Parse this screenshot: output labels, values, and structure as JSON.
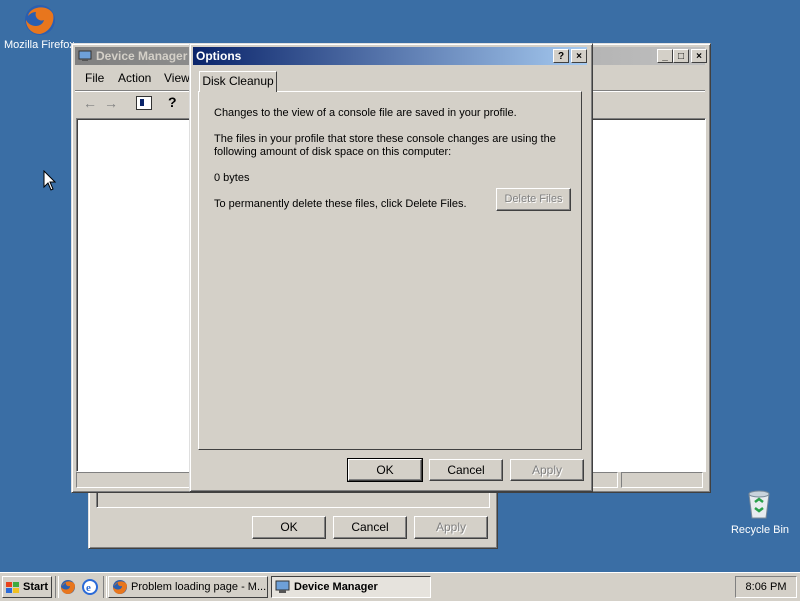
{
  "desktop": {
    "firefox_label": "Mozilla Firefox",
    "recycle_label": "Recycle Bin"
  },
  "device_manager": {
    "title": "Device Manager",
    "menu": [
      "File",
      "Action",
      "View"
    ]
  },
  "back_dialog": {
    "ok": "OK",
    "cancel": "Cancel",
    "apply": "Apply"
  },
  "options": {
    "title": "Options",
    "help_btn": "?",
    "close_btn": "×",
    "tab": "Disk Cleanup",
    "line1": "Changes to the view of a console file are saved in your profile.",
    "line2a": "The files in your profile that store these console changes are using the",
    "line2b": "following amount of disk space on this computer:",
    "size": "0 bytes",
    "delete_prompt": "To permanently delete these files, click Delete Files.",
    "delete_button": "Delete Files",
    "ok": "OK",
    "cancel": "Cancel",
    "apply": "Apply"
  },
  "taskbar": {
    "start": "Start",
    "task1": "Problem loading page - M...",
    "task2": "Device Manager",
    "clock": "8:06 PM"
  }
}
